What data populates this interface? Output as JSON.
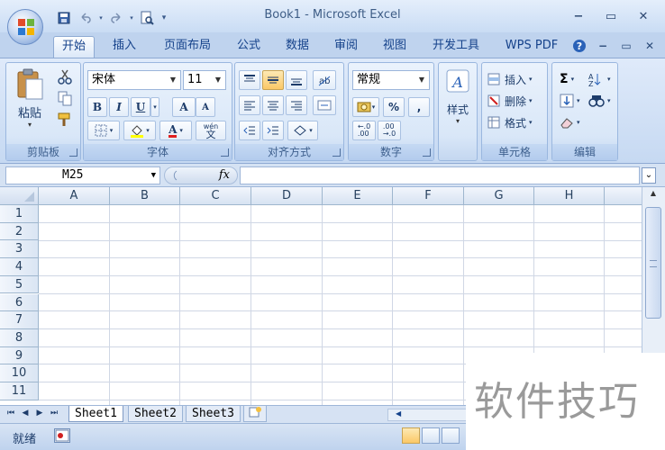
{
  "window": {
    "title": "Book1 - Microsoft Excel",
    "controls": {
      "minimize": "−",
      "restore": "▭",
      "close": "✕"
    }
  },
  "quick_access": [
    "save-icon",
    "undo-icon",
    "redo-icon",
    "print-preview-icon",
    "customize-icon"
  ],
  "tabs": [
    {
      "label": "开始",
      "active": true
    },
    {
      "label": "插入"
    },
    {
      "label": "页面布局"
    },
    {
      "label": "公式"
    },
    {
      "label": "数据"
    },
    {
      "label": "审阅"
    },
    {
      "label": "视图"
    },
    {
      "label": "开发工具"
    },
    {
      "label": "WPS PDF"
    }
  ],
  "ribbon": {
    "clipboard": {
      "label": "剪贴板",
      "paste": "粘贴"
    },
    "font": {
      "label": "字体",
      "font_name": "宋体",
      "font_size": "11",
      "bold": "B",
      "italic": "I",
      "underline": "U",
      "grow": "A",
      "shrink": "A",
      "pinyin": "wén"
    },
    "alignment": {
      "label": "对齐方式"
    },
    "number": {
      "label": "数字",
      "format": "常规",
      "percent": "%",
      "comma": ","
    },
    "styles": {
      "label": "样式"
    },
    "cells": {
      "label": "单元格",
      "insert": "插入",
      "delete": "删除",
      "format": "格式"
    },
    "editing": {
      "label": "编辑",
      "sigma": "Σ"
    }
  },
  "formula_bar": {
    "name_box": "M25",
    "fx": "fx",
    "value": ""
  },
  "columns": [
    "A",
    "B",
    "C",
    "D",
    "E",
    "F",
    "G",
    "H"
  ],
  "rows": [
    "1",
    "2",
    "3",
    "4",
    "5",
    "6",
    "7",
    "8",
    "9",
    "10",
    "11"
  ],
  "sheets": [
    {
      "label": "Sheet1",
      "active": true
    },
    {
      "label": "Sheet2"
    },
    {
      "label": "Sheet3"
    }
  ],
  "status": {
    "text": "就绪"
  },
  "watermark": "软件技巧",
  "colors": {
    "ribbon_bg": "#dfeafa",
    "title_bg": "#e4eefb",
    "accent_selected": "#fbc867"
  }
}
